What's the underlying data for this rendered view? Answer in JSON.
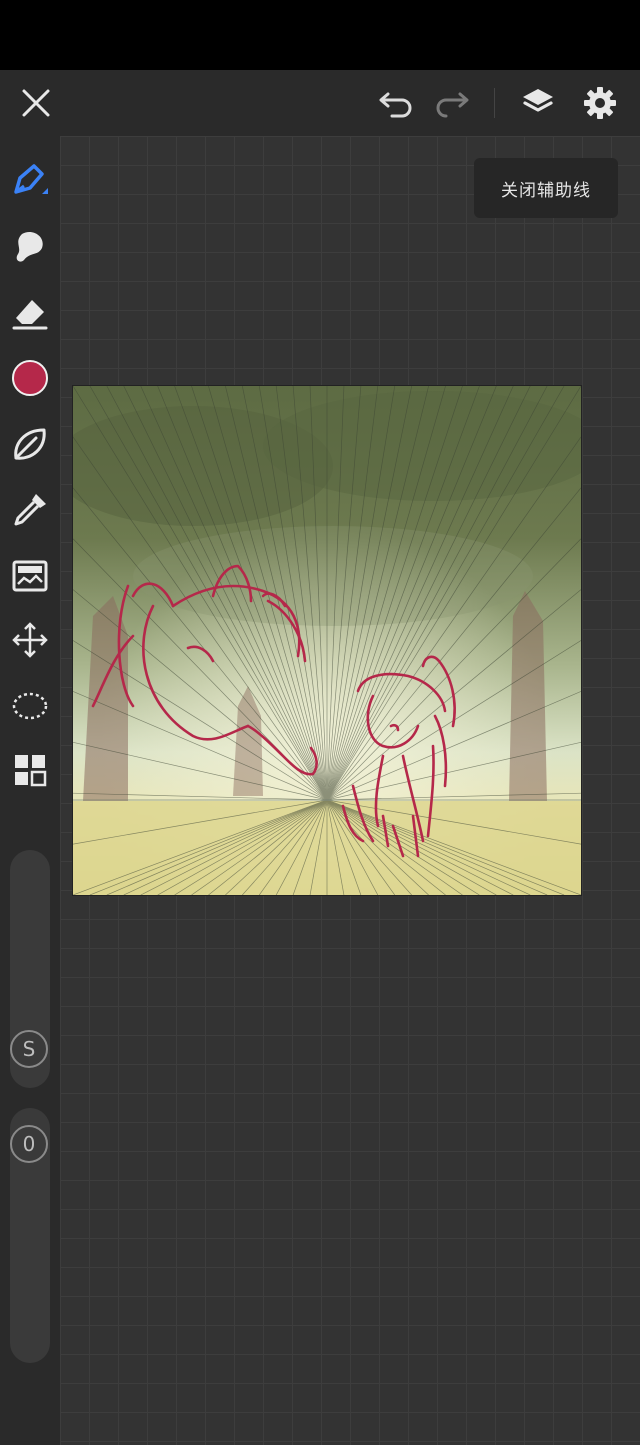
{
  "topbar": {
    "close_icon": "close-icon",
    "undo_icon": "undo-icon",
    "redo_icon": "redo-icon",
    "layers_icon": "layers-icon",
    "settings_icon": "gear-icon"
  },
  "guide_toggle": {
    "label": "关闭辅助线"
  },
  "tools": [
    {
      "name": "pencil",
      "icon": "pencil-icon",
      "active": true
    },
    {
      "name": "smudge",
      "icon": "smudge-icon"
    },
    {
      "name": "eraser",
      "icon": "eraser-icon"
    },
    {
      "name": "color",
      "icon": "color-swatch",
      "color": "#b5284a"
    },
    {
      "name": "lasso",
      "icon": "lasso-icon"
    },
    {
      "name": "eyedropper",
      "icon": "eyedropper-icon"
    },
    {
      "name": "adjust",
      "icon": "adjust-icon"
    },
    {
      "name": "transform",
      "icon": "transform-icon"
    },
    {
      "name": "selection",
      "icon": "selection-icon"
    },
    {
      "name": "gallery",
      "icon": "grid-icon"
    }
  ],
  "sliders": {
    "size_badge": "S",
    "opacity_badge": "0"
  },
  "colors": {
    "accent": "#3b82f6",
    "brush": "#b5284a"
  }
}
